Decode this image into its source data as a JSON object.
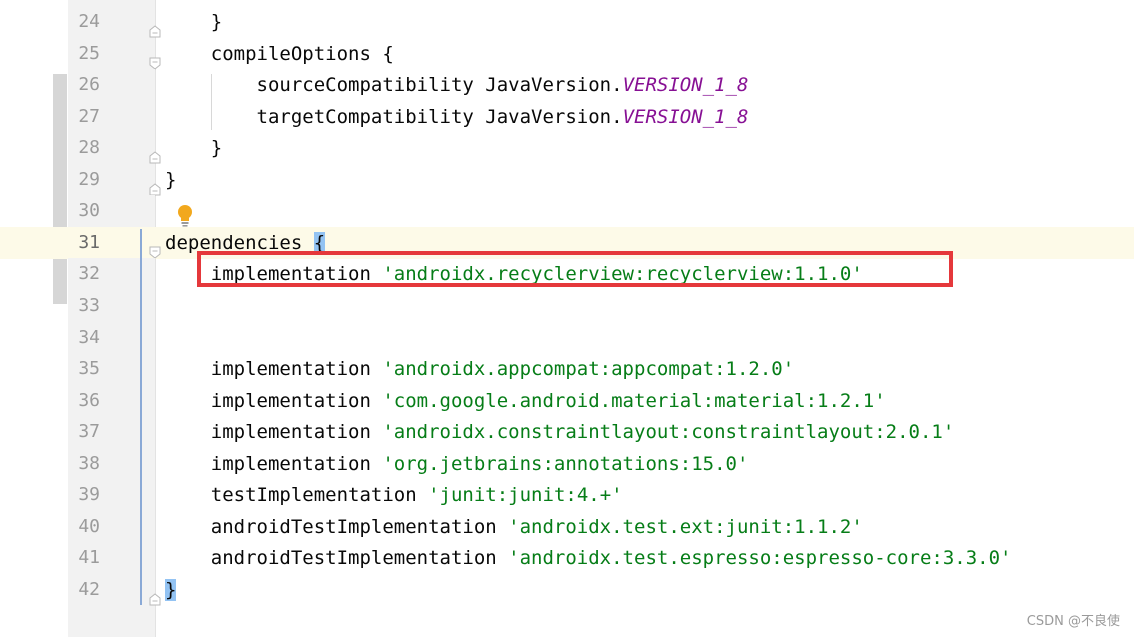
{
  "editor": {
    "lines": [
      {
        "num": "24",
        "fold": "end",
        "segments": [
          {
            "text": "    }",
            "cls": ""
          }
        ]
      },
      {
        "num": "25",
        "fold": "start",
        "segments": [
          {
            "text": "    compileOptions {",
            "cls": ""
          }
        ]
      },
      {
        "num": "26",
        "fold": "",
        "segments": [
          {
            "text": "        sourceCompatibility JavaVersion.",
            "cls": ""
          },
          {
            "text": "VERSION_1_8",
            "cls": "const"
          }
        ]
      },
      {
        "num": "27",
        "fold": "",
        "segments": [
          {
            "text": "        targetCompatibility JavaVersion.",
            "cls": ""
          },
          {
            "text": "VERSION_1_8",
            "cls": "const"
          }
        ]
      },
      {
        "num": "28",
        "fold": "end",
        "segments": [
          {
            "text": "    }",
            "cls": ""
          }
        ]
      },
      {
        "num": "29",
        "fold": "end",
        "segments": [
          {
            "text": "}",
            "cls": ""
          }
        ]
      },
      {
        "num": "30",
        "fold": "",
        "segments": []
      },
      {
        "num": "31",
        "fold": "start",
        "current": true,
        "segments": [
          {
            "text": "dependencies ",
            "cls": ""
          },
          {
            "text": "{",
            "cls": "brace-hl"
          }
        ]
      },
      {
        "num": "32",
        "fold": "",
        "segments": [
          {
            "text": "    implementation ",
            "cls": ""
          },
          {
            "text": "'androidx.recyclerview:recyclerview:1.1.0'",
            "cls": "str"
          }
        ]
      },
      {
        "num": "33",
        "fold": "",
        "segments": []
      },
      {
        "num": "34",
        "fold": "",
        "segments": []
      },
      {
        "num": "35",
        "fold": "",
        "segments": [
          {
            "text": "    implementation ",
            "cls": ""
          },
          {
            "text": "'androidx.appcompat:appcompat:1.2.0'",
            "cls": "str"
          }
        ]
      },
      {
        "num": "36",
        "fold": "",
        "segments": [
          {
            "text": "    implementation ",
            "cls": ""
          },
          {
            "text": "'com.google.android.material:material:1.2.1'",
            "cls": "str"
          }
        ]
      },
      {
        "num": "37",
        "fold": "",
        "segments": [
          {
            "text": "    implementation ",
            "cls": ""
          },
          {
            "text": "'androidx.constraintlayout:constraintlayout:2.0.1'",
            "cls": "str"
          }
        ]
      },
      {
        "num": "38",
        "fold": "",
        "segments": [
          {
            "text": "    implementation ",
            "cls": ""
          },
          {
            "text": "'org.jetbrains:annotations:15.0'",
            "cls": "str"
          }
        ]
      },
      {
        "num": "39",
        "fold": "",
        "segments": [
          {
            "text": "    testImplementation ",
            "cls": ""
          },
          {
            "text": "'junit:junit:4.+'",
            "cls": "str"
          }
        ]
      },
      {
        "num": "40",
        "fold": "",
        "segments": [
          {
            "text": "    androidTestImplementation ",
            "cls": ""
          },
          {
            "text": "'androidx.test.ext:junit:1.1.2'",
            "cls": "str"
          }
        ]
      },
      {
        "num": "41",
        "fold": "",
        "segments": [
          {
            "text": "    androidTestImplementation ",
            "cls": ""
          },
          {
            "text": "'androidx.test.espresso:espresso-core:3.3.0'",
            "cls": "str"
          }
        ]
      },
      {
        "num": "42",
        "fold": "end",
        "segments": [
          {
            "text": "}",
            "cls": "brace-hl"
          }
        ]
      }
    ]
  },
  "watermark": "CSDN @不良使",
  "colors": {
    "string": "#067d17",
    "constant": "#871094",
    "highlight_box": "#e5383b",
    "brace_match": "#93c3f3",
    "current_line": "#fdfae8"
  },
  "icons": {
    "intention_bulb": "lightbulb-icon",
    "fold_start": "fold-start-icon",
    "fold_end": "fold-end-icon"
  }
}
